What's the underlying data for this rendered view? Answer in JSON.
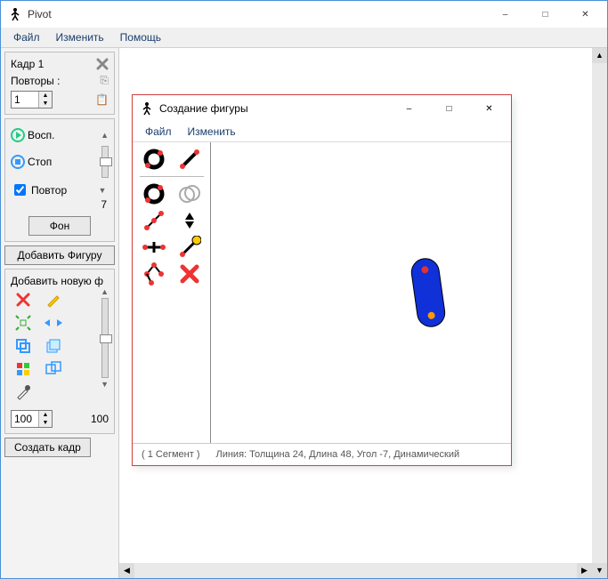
{
  "main_window": {
    "title": "Pivot",
    "menu": {
      "file": "Файл",
      "edit": "Изменить",
      "help": "Помощь"
    }
  },
  "frame_panel": {
    "frame_label": "Кадр 1",
    "repeats_label": "Повторы :",
    "repeats_value": "1"
  },
  "play_panel": {
    "play_label": "Восп.",
    "stop_label": "Стоп",
    "loop_label": "Повтор",
    "fps_value": "7"
  },
  "bg_button": "Фон",
  "add_figure_button": "Добавить Фигуру",
  "add_new_label": "Добавить новую ф",
  "scale_value": "100",
  "scale_display": "100",
  "create_frame_button": "Создать кадр",
  "sub_window": {
    "title": "Создание фигуры",
    "menu": {
      "file": "Файл",
      "edit": "Изменить"
    },
    "status_seg": "( 1 Сегмент )",
    "status_info": "Линия: Толщина 24, Длина 48, Угол -7, Динамический"
  },
  "icons": {
    "copy": "⎘",
    "paste": "📋",
    "up": "▲",
    "down": "▼",
    "left": "◀",
    "right": "▶"
  }
}
